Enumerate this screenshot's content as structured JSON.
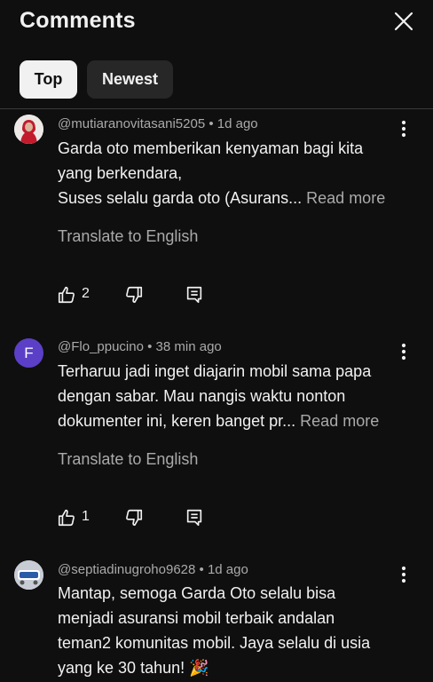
{
  "header": {
    "title": "Comments",
    "close_icon": "close-icon"
  },
  "tabs": [
    {
      "label": "Top",
      "selected": true
    },
    {
      "label": "Newest",
      "selected": false
    }
  ],
  "comments": [
    {
      "author": "@mutiaranovitasani5205",
      "separator": " • ",
      "time": "1d ago",
      "lines": [
        "Garda oto memberikan kenyaman bagi kita",
        "yang berkendara,",
        "Suses selalu garda oto (Asurans..."
      ],
      "read_more": " Read more",
      "translate": "Translate to English",
      "likes": "2",
      "avatar": {
        "type": "photo",
        "colors": [
          "#c21b2c",
          "#e8e4e0"
        ]
      }
    },
    {
      "author": "@Flo_ppucino",
      "separator": " • ",
      "time": "38 min ago",
      "lines": [
        "Terharuu jadi inget diajarin mobil sama papa",
        "dengan sabar. Mau nangis waktu nonton",
        "dokumenter ini, keren banget pr..."
      ],
      "read_more": " Read more",
      "translate": "Translate to English",
      "likes": "1",
      "avatar": {
        "type": "letter",
        "letter": "F",
        "color": "#5c3fc7"
      }
    },
    {
      "author": "@septiadinugroho9628",
      "separator": " • ",
      "time": "1d ago",
      "lines": [
        "Mantap, semoga Garda Oto selalu bisa",
        "menjadi asuransi mobil terbaik andalan",
        "teman2 komunitas mobil. Jaya selalu di usia",
        "yang ke 30 tahun! 🎉"
      ],
      "avatar": {
        "type": "photo",
        "colors": [
          "#c8ccd4",
          "#2b5aa8"
        ]
      }
    }
  ]
}
